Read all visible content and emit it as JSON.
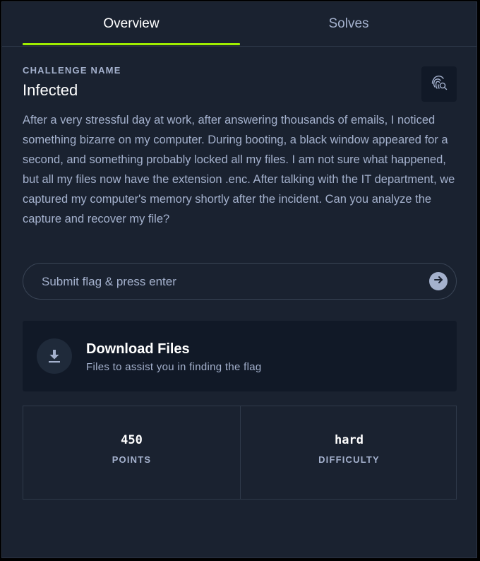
{
  "tabs": [
    {
      "label": "Overview",
      "active": true
    },
    {
      "label": "Solves",
      "active": false
    }
  ],
  "colors": {
    "accent": "#9fef00",
    "panel_bg": "#1a2230",
    "card_bg": "#111927",
    "muted_text": "#a4b1cd"
  },
  "challenge": {
    "name_label": "CHALLENGE NAME",
    "name": "Infected",
    "action_icon": "fingerprint-search-icon",
    "description": "After a very stressful day at work, after answering thousands of emails, I noticed something bizarre on my computer. During booting, a black window appeared for a second, and something probably locked all my files. I am not sure what happened, but all my files now have the extension .enc. After talking with the IT department, we captured my computer's memory shortly after the incident. Can you analyze the capture and recover my file?"
  },
  "flag": {
    "placeholder": "Submit flag & press enter",
    "value": "",
    "submit_icon": "arrow-right-circle-icon"
  },
  "download": {
    "icon": "download-icon",
    "title": "Download Files",
    "subtitle": "Files to assist you in finding the flag"
  },
  "stats": {
    "points_value": "450",
    "points_label": "POINTS",
    "difficulty_value": "hard",
    "difficulty_label": "DIFFICULTY"
  }
}
